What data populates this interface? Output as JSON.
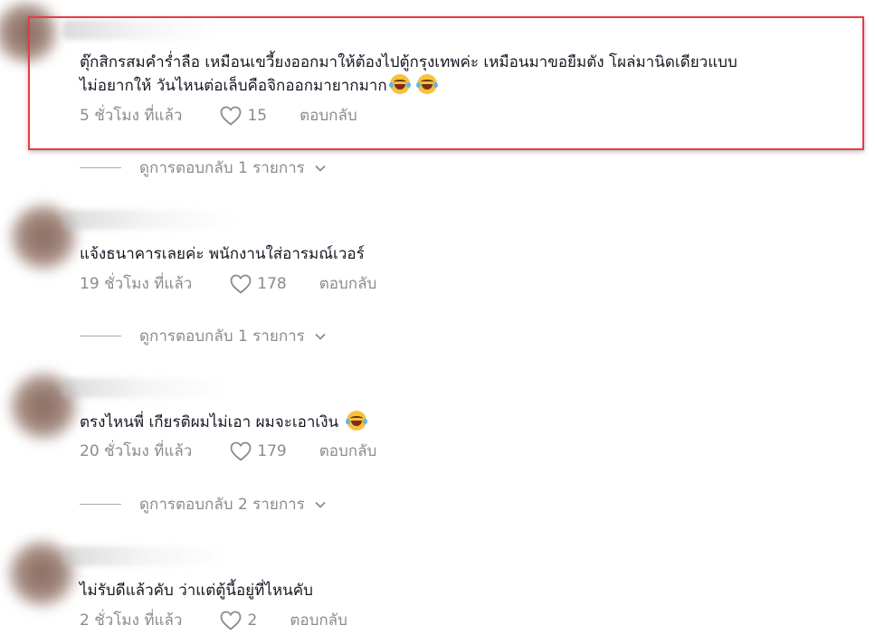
{
  "comments": [
    {
      "text_line1": "ตุ๊กสิกรสมคำร่ำลือ เหมือนเขวี้ยงออกมาให้ต้องไปตู้กรุงเทพค่ะ เหมือนมาขอยืมตัง โผล่มานิดเดียวแบบ",
      "text_line2": "ไม่อยากให้ วันไหนต่อเล็บคือจิกออกมายากมาก",
      "emoji_count": 2,
      "time": "5 ชั่วโมง ที่แล้ว",
      "likes": "15",
      "reply": "ตอบกลับ",
      "view_replies": "ดูการตอบกลับ 1 รายการ",
      "highlighted": true
    },
    {
      "text_line1": "แจ้งธนาคารเลยค่ะ พนักงานใส่อารมณ์เวอร์",
      "time": "19 ชั่วโมง ที่แล้ว",
      "likes": "178",
      "reply": "ตอบกลับ",
      "view_replies": "ดูการตอบกลับ 1 รายการ"
    },
    {
      "text_line1": "ตรงไหนพี่ เกียรติผมไม่เอา ผมจะเอาเงิน",
      "emoji_count": 1,
      "time": "20 ชั่วโมง ที่แล้ว",
      "likes": "179",
      "reply": "ตอบกลับ",
      "view_replies": "ดูการตอบกลับ 2 รายการ"
    },
    {
      "text_line1": "ไม่รับดีแล้วคับ ว่าแต่ตู้นี้อยู่ที่ไหนคับ",
      "time": "2 ชั่วโมง ที่แล้ว",
      "likes": "2",
      "reply": "ตอบกลับ"
    }
  ],
  "icons": {
    "like": "heart-outline-icon",
    "expand": "chevron-down-icon",
    "emoji": "laughing-tears-emoji"
  },
  "colors": {
    "highlight": "#e83b45",
    "secondary_text": "#8a8b91"
  }
}
